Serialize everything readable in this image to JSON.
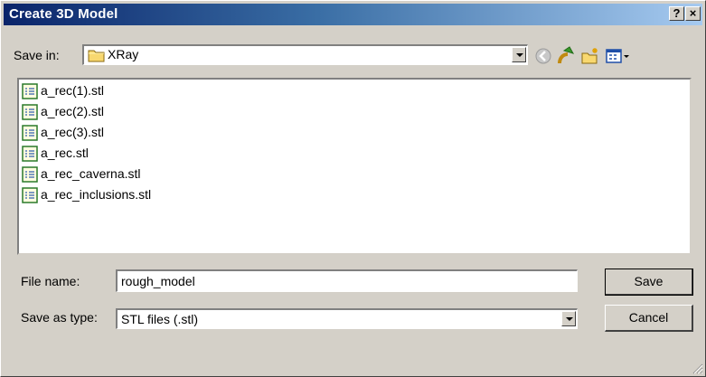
{
  "window": {
    "title": "Create 3D Model",
    "help_label": "?",
    "close_label": "×"
  },
  "toolbar": {
    "save_in_label": "Save in:",
    "save_in_value": "XRay",
    "icons": [
      "back-icon",
      "up-folder-icon",
      "new-folder-icon",
      "view-menu-icon"
    ]
  },
  "files": [
    {
      "name": "a_rec(1).stl"
    },
    {
      "name": "a_rec(2).stl"
    },
    {
      "name": "a_rec(3).stl"
    },
    {
      "name": "a_rec.stl"
    },
    {
      "name": "a_rec_caverna.stl"
    },
    {
      "name": "a_rec_inclusions.stl"
    }
  ],
  "form": {
    "file_name_label": "File name:",
    "file_name_value": "rough_model",
    "save_type_label": "Save as type:",
    "save_type_value": "STL files (.stl)"
  },
  "buttons": {
    "save": "Save",
    "cancel": "Cancel"
  },
  "colors": {
    "titlebar_start": "#0a246a",
    "titlebar_end": "#a6caf0",
    "face": "#d4d0c8"
  }
}
